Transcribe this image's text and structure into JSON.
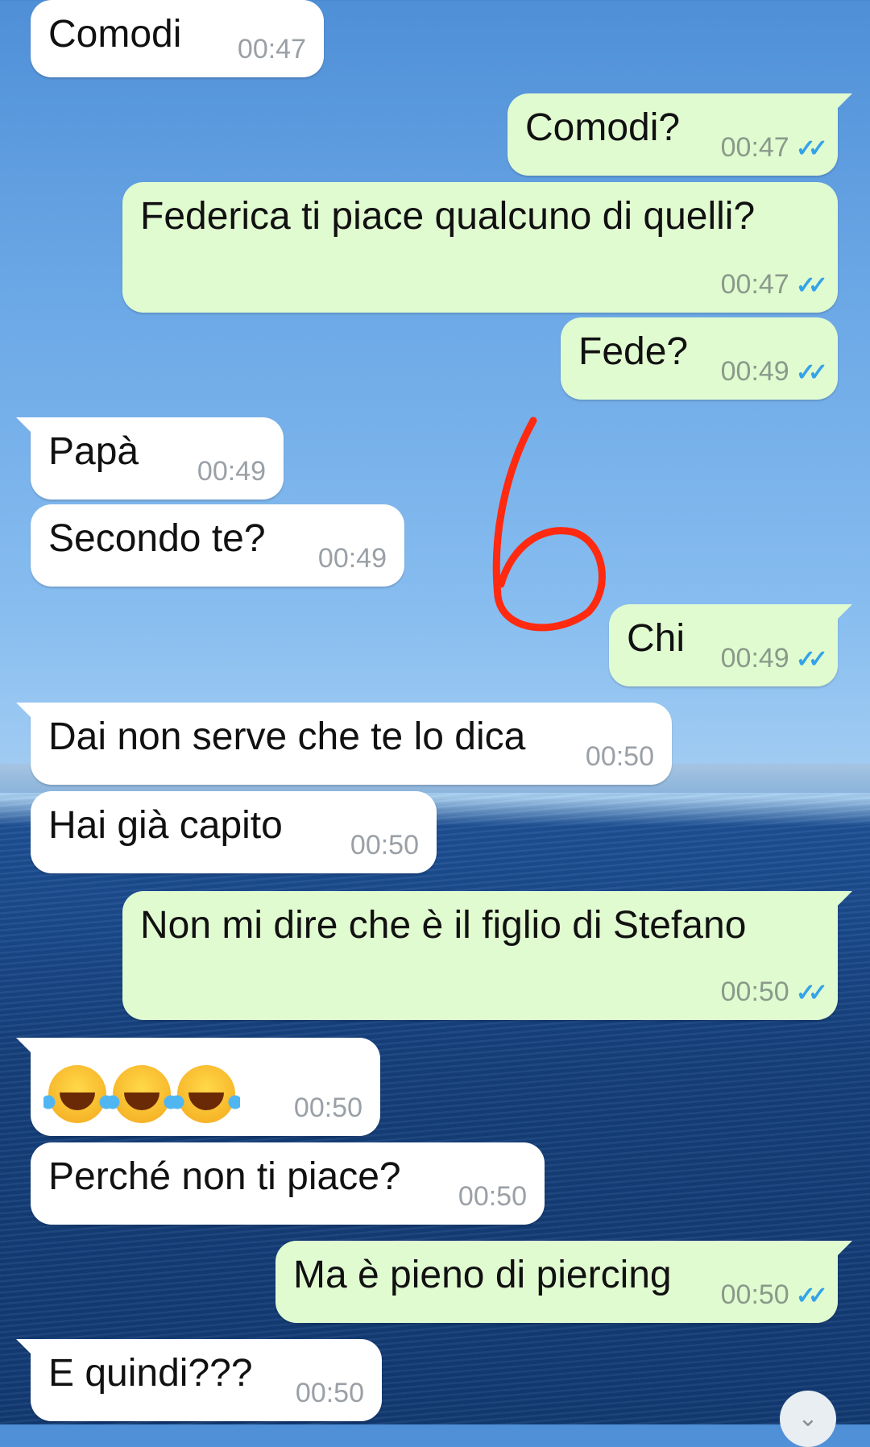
{
  "messages": [
    {
      "text": "Comodi",
      "time": "00:47"
    },
    {
      "text": "Comodi?",
      "time": "00:47"
    },
    {
      "text": "Federica ti piace qualcuno di quelli?",
      "time": "00:47"
    },
    {
      "text": "Fede?",
      "time": "00:49"
    },
    {
      "text": "Papà",
      "time": "00:49"
    },
    {
      "text": "Secondo te?",
      "time": "00:49"
    },
    {
      "text": "Chi",
      "time": "00:49"
    },
    {
      "text": "Dai non serve che te lo dica",
      "time": "00:50"
    },
    {
      "text": "Hai già capito",
      "time": "00:50"
    },
    {
      "text": "Non mi dire che è il figlio di Stefano",
      "time": "00:50"
    },
    {
      "text": "😂😂😂",
      "time": "00:50"
    },
    {
      "text": "Perché non ti piace?",
      "time": "00:50"
    },
    {
      "text": "Ma è pieno di piercing",
      "time": "00:50"
    },
    {
      "text": "E quindi???",
      "time": "00:50"
    }
  ],
  "read_ticks": "✓✓",
  "scroll_icon": "chevron-down-icon",
  "colors": {
    "incoming": "#ffffff",
    "outgoing": "#e1fbd1",
    "ticks": "#34a3e8",
    "annotation": "#ff2a10"
  }
}
